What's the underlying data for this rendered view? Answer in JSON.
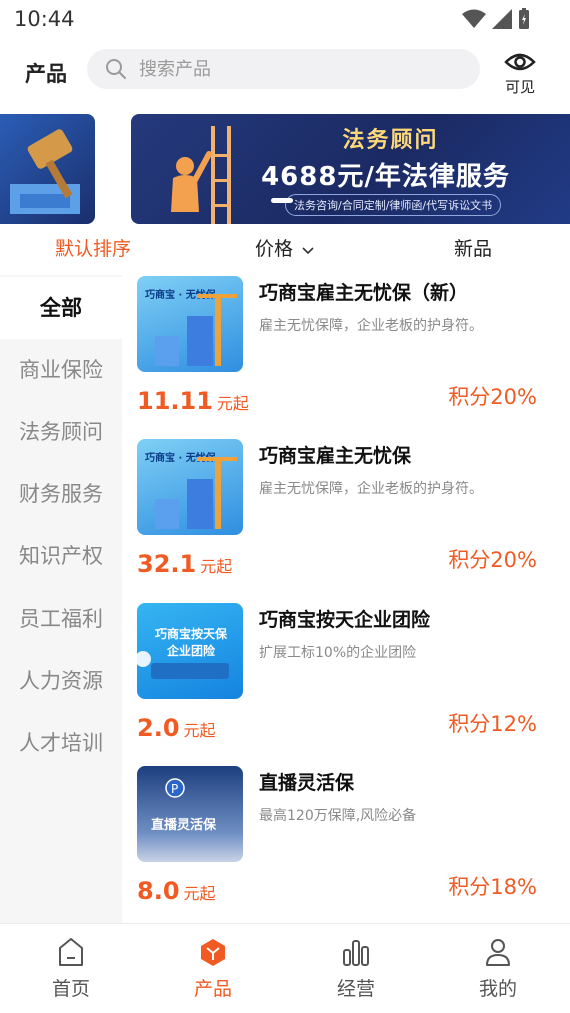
{
  "status_bar": {
    "time": "10:44"
  },
  "header": {
    "title": "产品",
    "search_placeholder": "搜索产品",
    "visible_label": "可见"
  },
  "banner": {
    "title": "法务顾问",
    "price_text": "4688元/年法律服务",
    "services": "法务咨询/合同定制/律师函/代写诉讼文书"
  },
  "sort_tabs": [
    {
      "label": "默认排序",
      "active": true
    },
    {
      "label": "价格",
      "active": false
    },
    {
      "label": "新品",
      "active": false
    }
  ],
  "categories": [
    {
      "label": "全部",
      "active": true
    },
    {
      "label": "商业保险"
    },
    {
      "label": "法务顾问"
    },
    {
      "label": "财务服务"
    },
    {
      "label": "知识产权"
    },
    {
      "label": "员工福利"
    },
    {
      "label": "人力资源"
    },
    {
      "label": "人才培训"
    }
  ],
  "products": [
    {
      "name": "巧商宝雇主无忧保（新）",
      "desc": "雇主无忧保障，企业老板的护身符。",
      "price": "11.11",
      "unit": "元起",
      "points": "积分20%",
      "thumb_text": "巧商宝 · 无忧保"
    },
    {
      "name": "巧商宝雇主无忧保",
      "desc": "雇主无忧保障，企业老板的护身符。",
      "price": "32.1",
      "unit": "元起",
      "points": "积分20%",
      "thumb_text": "巧商宝 · 无忧保"
    },
    {
      "name": "巧商宝按天企业团险",
      "desc": "扩展工标10%的企业团险",
      "price": "2.0",
      "unit": "元起",
      "points": "积分12%",
      "thumb_text": "巧商宝按天保 企业团险"
    },
    {
      "name": "直播灵活保",
      "desc": "最高120万保障,风险必备",
      "price": "8.0",
      "unit": "元起",
      "points": "积分18%",
      "thumb_text": "直播灵活保"
    }
  ],
  "bottom_nav": [
    {
      "label": "首页",
      "icon": "home-icon"
    },
    {
      "label": "产品",
      "icon": "product-cube-icon",
      "active": true
    },
    {
      "label": "经营",
      "icon": "bar-chart-icon"
    },
    {
      "label": "我的",
      "icon": "person-icon"
    }
  ],
  "colors": {
    "accent": "#f15a22",
    "sidebar_bg": "#f6f6f7",
    "search_bg": "#f1f1f3"
  }
}
